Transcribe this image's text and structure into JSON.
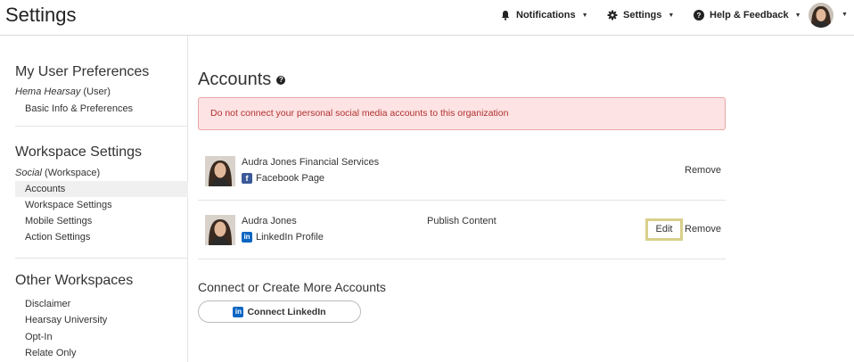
{
  "header": {
    "title": "Settings",
    "notifications_label": "Notifications",
    "settings_label": "Settings",
    "help_label": "Help & Feedback"
  },
  "sidebar": {
    "user_prefs": {
      "title": "My User Preferences",
      "user_name": "Hema Hearsay",
      "user_role": "(User)",
      "items": [
        "Basic Info & Preferences"
      ]
    },
    "workspace": {
      "title": "Workspace Settings",
      "workspace_name": "Social",
      "workspace_type": "(Workspace)",
      "items": [
        "Accounts",
        "Workspace Settings",
        "Mobile Settings",
        "Action Settings"
      ],
      "active": "Accounts"
    },
    "other": {
      "title": "Other Workspaces",
      "items": [
        "Disclaimer",
        "Hearsay University",
        "Opt-In",
        "Relate Only"
      ]
    }
  },
  "main": {
    "title": "Accounts",
    "help_glyph": "?",
    "alert": "Do not connect your personal social media accounts to this organization",
    "accounts": [
      {
        "name": "Audra Jones Financial Services",
        "type": "Facebook Page",
        "network_icon": "facebook-icon",
        "permission": "",
        "edit_label": "",
        "remove_label": "Remove"
      },
      {
        "name": "Audra Jones",
        "type": "LinkedIn Profile",
        "network_icon": "linkedin-icon",
        "permission": "Publish Content",
        "edit_label": "Edit",
        "remove_label": "Remove"
      }
    ],
    "more_title": "Connect or Create More Accounts",
    "connect_label": "Connect LinkedIn"
  },
  "colors": {
    "alert_bg": "#fde3e3",
    "alert_text": "#b03030",
    "facebook": "#3b5998",
    "linkedin": "#0a66c2",
    "edit_highlight": "#d8d08a"
  }
}
